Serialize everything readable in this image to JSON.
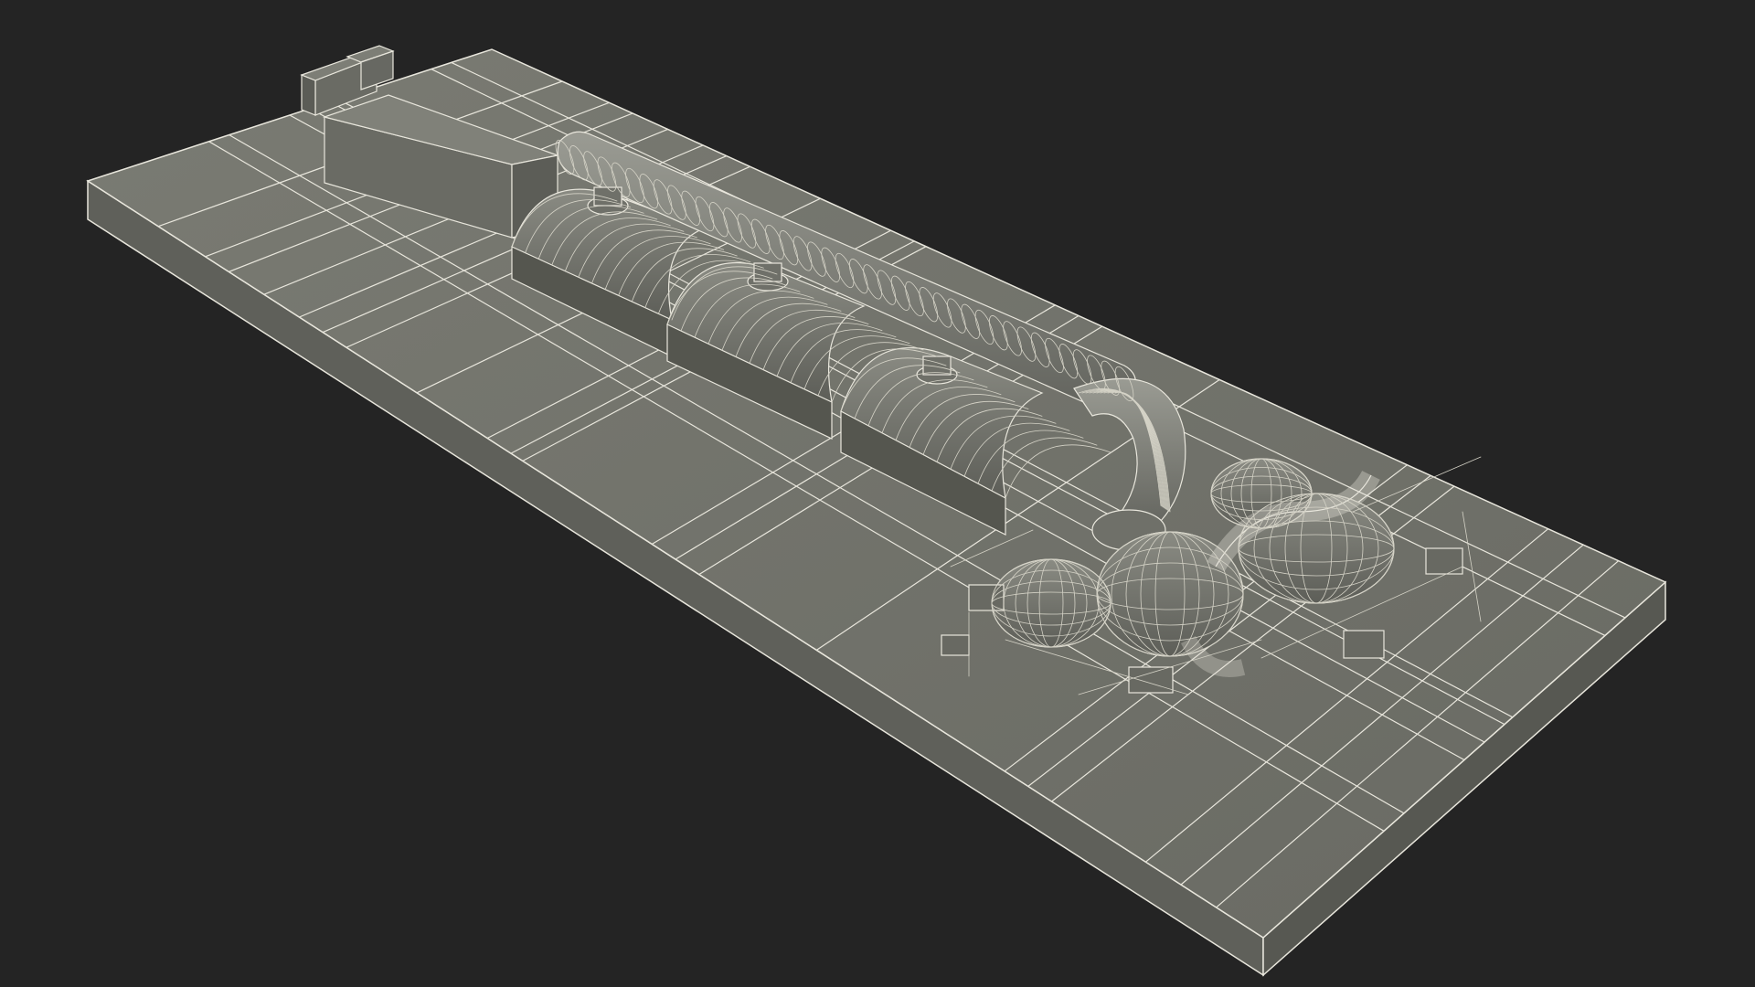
{
  "scene": {
    "subject": "turbine-generator-set-wireframe-render",
    "background_color": "#242424",
    "surface_color": "#71726a",
    "surface_side_color": "#5f605a",
    "wire_color": "#e8e6dc",
    "detail_color": "#d4d2c6",
    "machine_shadow_color": "#5a5b55"
  }
}
